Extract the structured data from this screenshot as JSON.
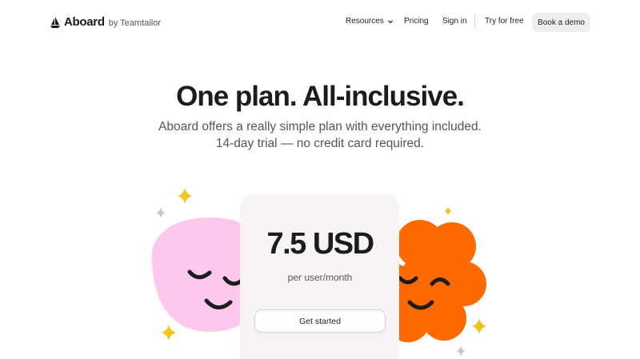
{
  "brand": {
    "name": "Aboard",
    "byline": "by Teamtailor"
  },
  "nav": {
    "resources": "Resources",
    "pricing": "Pricing",
    "sign_in": "Sign in",
    "try_free": "Try for free",
    "book_demo": "Book a demo"
  },
  "hero": {
    "title": "One plan. All-inclusive.",
    "subtitle_line1": "Aboard offers a really simple plan with everything included.",
    "subtitle_line2": "14-day trial — no credit card required."
  },
  "plan": {
    "price": "7.5 USD",
    "period": "per user/month",
    "cta": "Get started"
  },
  "colors": {
    "pink_blob": "#fdc8ec",
    "orange_blob": "#ff6a00",
    "star_yellow": "#f5c21b",
    "star_gray": "#c8c8c8",
    "card_bg": "#f7f4f3"
  }
}
